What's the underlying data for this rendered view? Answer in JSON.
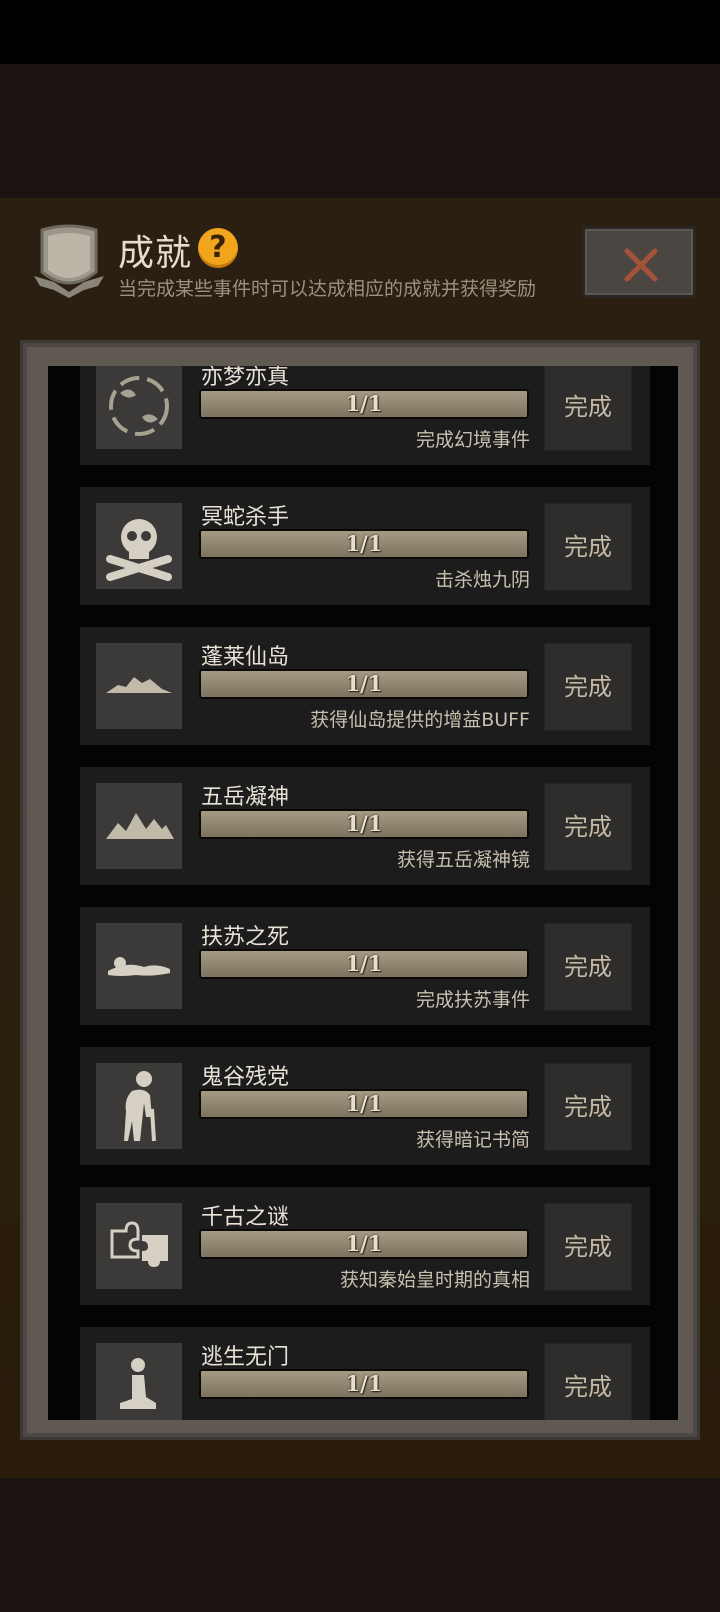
{
  "header": {
    "title": "成就",
    "subtitle": "当完成某些事件时可以达成相应的成就并获得奖励",
    "help_icon": "question-mark-icon",
    "close_icon": "close-x-icon"
  },
  "colors": {
    "panel_bg": "#2a1f10",
    "help_icon": "#f0a51c",
    "close_x": "#a4533a",
    "progress_fill": "#918771"
  },
  "achievements": [
    {
      "name": "亦梦亦真",
      "progress": "1/1",
      "progress_fraction": 1.0,
      "desc": "完成幻境事件",
      "button": "完成",
      "icon": "swirl-icon"
    },
    {
      "name": "冥蛇杀手",
      "progress": "1/1",
      "progress_fraction": 1.0,
      "desc": "击杀烛九阴",
      "button": "完成",
      "icon": "skull-crossbones-icon"
    },
    {
      "name": "蓬莱仙岛",
      "progress": "1/1",
      "progress_fraction": 1.0,
      "desc": "获得仙岛提供的增益BUFF",
      "button": "完成",
      "icon": "island-icon"
    },
    {
      "name": "五岳凝神",
      "progress": "1/1",
      "progress_fraction": 1.0,
      "desc": "获得五岳凝神镜",
      "button": "完成",
      "icon": "mountains-icon"
    },
    {
      "name": "扶苏之死",
      "progress": "1/1",
      "progress_fraction": 1.0,
      "desc": "完成扶苏事件",
      "button": "完成",
      "icon": "lying-person-icon"
    },
    {
      "name": "鬼谷残党",
      "progress": "1/1",
      "progress_fraction": 1.0,
      "desc": "获得暗记书简",
      "button": "完成",
      "icon": "old-man-cane-icon"
    },
    {
      "name": "千古之谜",
      "progress": "1/1",
      "progress_fraction": 1.0,
      "desc": "获知秦始皇时期的真相",
      "button": "完成",
      "icon": "puzzle-icon"
    },
    {
      "name": "逃生无门",
      "progress": "1/1",
      "progress_fraction": 1.0,
      "desc": "",
      "button": "完成",
      "icon": "kneeling-person-icon"
    }
  ]
}
